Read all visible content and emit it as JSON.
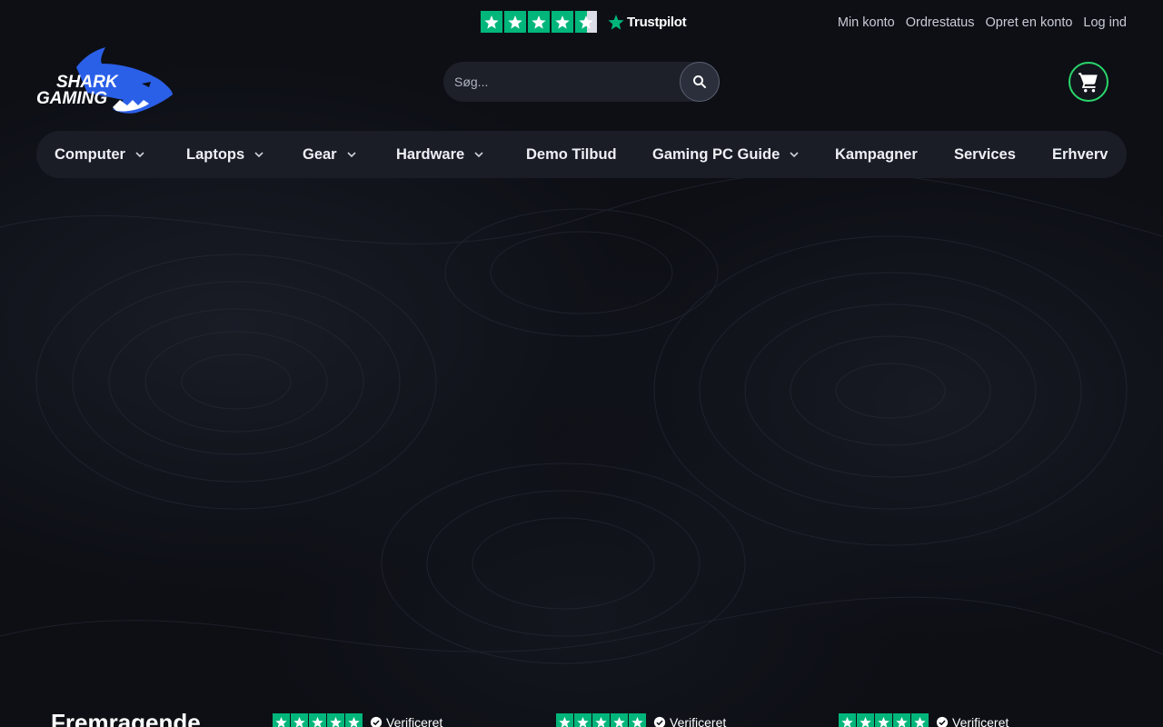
{
  "trustpilot": {
    "brand": "Trustpilot",
    "star_count": 5,
    "rating_fill": 0.9
  },
  "account": {
    "links": [
      "Min konto",
      "Ordrestatus",
      "Opret en konto",
      "Log ind"
    ]
  },
  "logo": {
    "line1": "SHARK",
    "line2": "GAMING",
    "accent": "#2a5fe8"
  },
  "search": {
    "placeholder": "Søg..."
  },
  "nav": {
    "items": [
      {
        "label": "Computer",
        "has_dropdown": true
      },
      {
        "label": "Laptops",
        "has_dropdown": true
      },
      {
        "label": "Gear",
        "has_dropdown": true
      },
      {
        "label": "Hardware",
        "has_dropdown": true
      },
      {
        "label": "Demo Tilbud",
        "has_dropdown": false
      },
      {
        "label": "Gaming PC Guide",
        "has_dropdown": true
      },
      {
        "label": "Kampagner",
        "has_dropdown": false
      },
      {
        "label": "Services",
        "has_dropdown": false
      },
      {
        "label": "Erhverv",
        "has_dropdown": false
      }
    ]
  },
  "reviews": {
    "summary_title": "Fremragende",
    "verified_label": "Verificeret",
    "count_visible": 3
  },
  "colors": {
    "trustpilot_green": "#00b67a",
    "cart_green": "#29d66a",
    "nav_bg": "#1a1d26",
    "page_bg": "#0d0f15"
  },
  "icons": {
    "search": "search-icon",
    "cart": "cart-icon",
    "chevron": "chevron-down-icon",
    "star": "star-icon",
    "verified": "verified-check-icon"
  }
}
